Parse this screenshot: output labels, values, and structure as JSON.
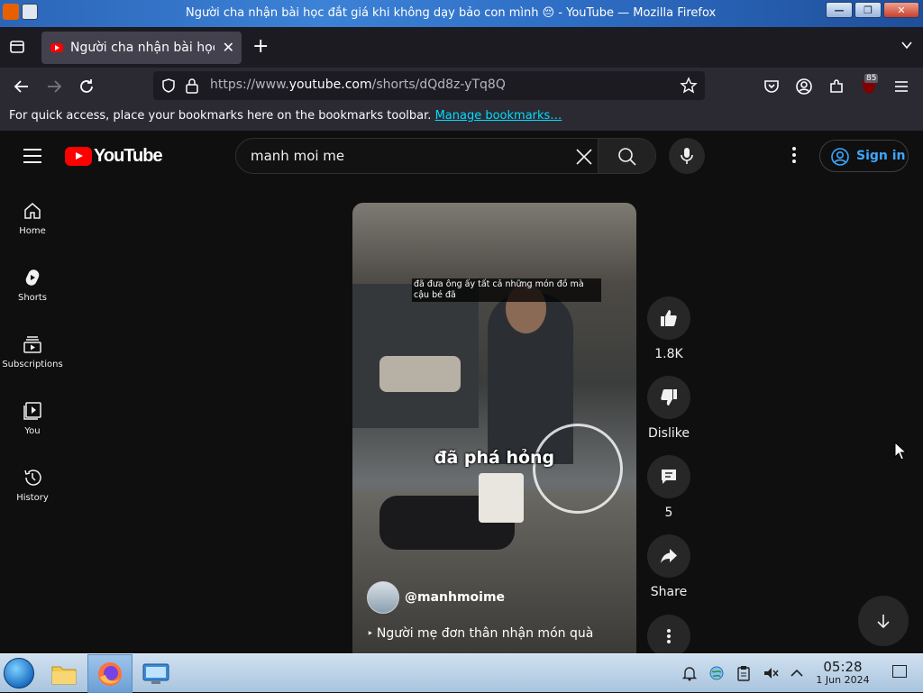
{
  "window": {
    "title": "Người cha nhận bài học đắt giá khi không dạy bảo con mình 😔 - YouTube — Mozilla Firefox",
    "buttons": [
      "minimize",
      "maximize",
      "close"
    ]
  },
  "browser": {
    "tab_title": "Người cha nhận bài học đắt giá khi không dạy bảo con mình 😔 - YouTube",
    "url_prefix": "https://www.",
    "url_host": "youtube.com",
    "url_path": "/shorts/dQd8z-yTq8Q",
    "extension_badge": "85",
    "bookmarks_text": "For quick access, place your bookmarks here on the bookmarks toolbar.",
    "bookmarks_link": "Manage bookmarks…"
  },
  "youtube": {
    "logo_text": "YouTube",
    "search_query": "manh moi me",
    "sign_in": "Sign in",
    "guide": [
      {
        "label": "Home",
        "icon": "home-icon"
      },
      {
        "label": "Shorts",
        "icon": "shorts-icon"
      },
      {
        "label": "Subscriptions",
        "icon": "subscriptions-icon"
      },
      {
        "label": "You",
        "icon": "you-icon"
      },
      {
        "label": "History",
        "icon": "history-icon"
      }
    ],
    "short": {
      "caption_small": "đã đưa ông ấy tất cả những món đồ mà cậu bé đã",
      "caption_big": "đã phá hỏng",
      "channel_handle": "@manhmoime",
      "video_title": "Người mẹ đơn thân nhận món quà"
    },
    "actions": {
      "like_count": "1.8K",
      "dislike_label": "Dislike",
      "comment_count": "5",
      "share_label": "Share"
    }
  },
  "taskbar": {
    "time": "05:28",
    "date": "1 Jun 2024"
  },
  "colors": {
    "yt_background": "#0f0f0f",
    "yt_red": "#ff0000",
    "link_blue": "#3ea6ff",
    "firefox_tabstrip": "#1c1b22"
  }
}
